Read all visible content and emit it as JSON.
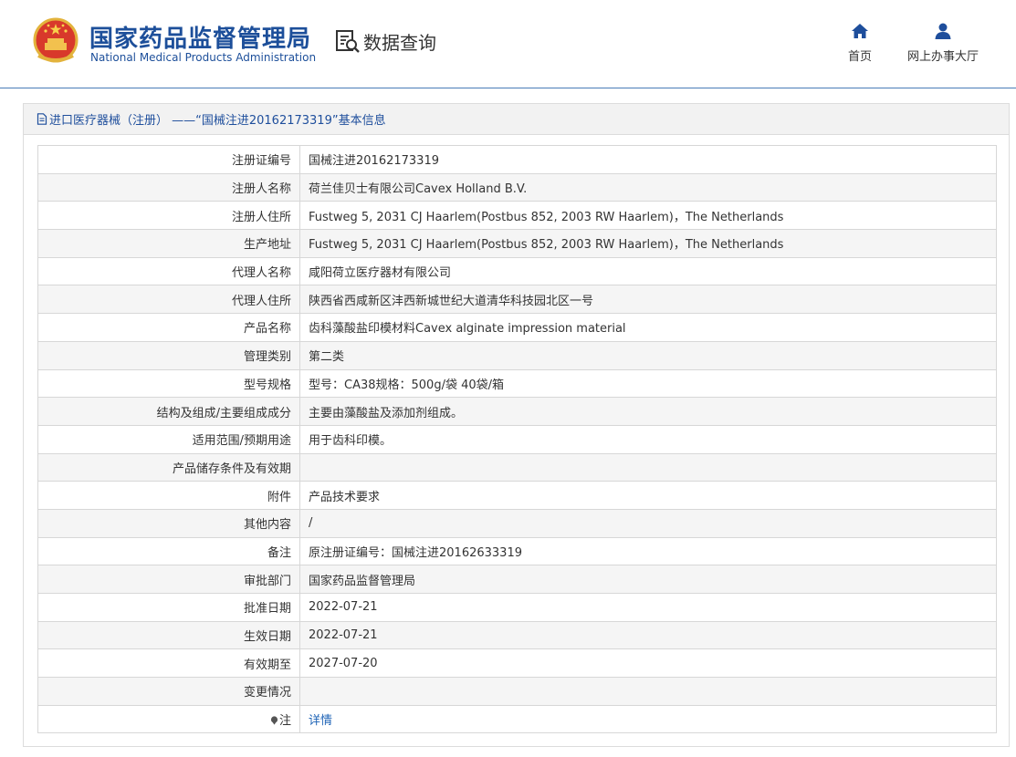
{
  "header": {
    "brand_cn": "国家药品监督管理局",
    "brand_en": "National Medical Products Administration",
    "query_label": "数据查询",
    "nav_home": "首页",
    "nav_hall": "网上办事大厅"
  },
  "panel": {
    "title": "进口医疗器械（注册） ——“国械注进20162173319”基本信息"
  },
  "rows": [
    {
      "label": "注册证编号",
      "value": "国械注进20162173319"
    },
    {
      "label": "注册人名称",
      "value": "荷兰佳贝士有限公司Cavex Holland B.V."
    },
    {
      "label": "注册人住所",
      "value": "Fustweg 5, 2031 CJ Haarlem(Postbus 852, 2003 RW Haarlem)，The Netherlands"
    },
    {
      "label": "生产地址",
      "value": "Fustweg 5, 2031 CJ Haarlem(Postbus 852, 2003 RW Haarlem)，The Netherlands"
    },
    {
      "label": "代理人名称",
      "value": "咸阳荷立医疗器材有限公司"
    },
    {
      "label": "代理人住所",
      "value": "陕西省西咸新区沣西新城世纪大道清华科技园北区一号"
    },
    {
      "label": "产品名称",
      "value": "齿科藻酸盐印模材料Cavex alginate impression material"
    },
    {
      "label": "管理类别",
      "value": "第二类"
    },
    {
      "label": "型号规格",
      "value": "型号：CA38规格：500g/袋 40袋/箱"
    },
    {
      "label": "结构及组成/主要组成成分",
      "value": "主要由藻酸盐及添加剂组成。"
    },
    {
      "label": "适用范围/预期用途",
      "value": "用于齿科印模。"
    },
    {
      "label": "产品储存条件及有效期",
      "value": ""
    },
    {
      "label": "附件",
      "value": "产品技术要求"
    },
    {
      "label": "其他内容",
      "value": "/"
    },
    {
      "label": "备注",
      "value": "原注册证编号：国械注进20162633319"
    },
    {
      "label": "审批部门",
      "value": "国家药品监督管理局"
    },
    {
      "label": "批准日期",
      "value": "2022-07-21"
    },
    {
      "label": "生效日期",
      "value": "2022-07-21"
    },
    {
      "label": "有效期至",
      "value": "2027-07-20"
    },
    {
      "label": "变更情况",
      "value": ""
    },
    {
      "label": "注",
      "value": "详情"
    }
  ],
  "colors": {
    "brand": "#1d4f9a",
    "link": "#1e63b6",
    "header_rule": "#4a7db8"
  },
  "icons": {
    "emblem": "national-emblem-icon",
    "query": "document-search-icon",
    "home": "home-icon",
    "hall": "user-icon",
    "panel": "document-icon",
    "note": "pin-icon"
  }
}
